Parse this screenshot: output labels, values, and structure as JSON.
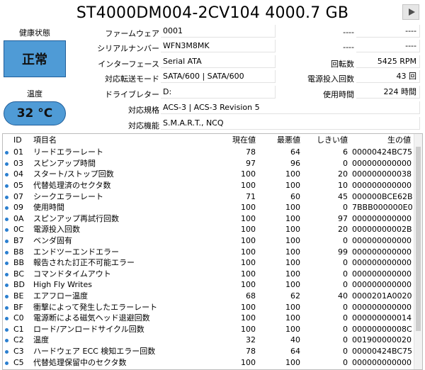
{
  "title": "ST4000DM004-2CV104 4000.7 GB",
  "health": {
    "label": "健康状態",
    "value": "正常",
    "color": "#4f9bd6"
  },
  "temperature": {
    "label": "温度",
    "value": "32 °C",
    "color": "#4f9bd6"
  },
  "info": {
    "firmware": {
      "label": "ファームウェア",
      "value": "0001"
    },
    "serial": {
      "label": "シリアルナンバー",
      "value": "WFN3M8MK"
    },
    "interface": {
      "label": "インターフェース",
      "value": "Serial ATA"
    },
    "transfer": {
      "label": "対応転送モード",
      "value": "SATA/600 | SATA/600"
    },
    "drive_letter": {
      "label": "ドライブレター",
      "value": "D:"
    },
    "standard": {
      "label": "対応規格",
      "value": "ACS-3 | ACS-3 Revision 5"
    },
    "features": {
      "label": "対応機能",
      "value": "S.M.A.R.T., NCQ"
    },
    "right_top_label": "----",
    "right_top_value": "----",
    "right_2_label": "----",
    "right_2_value": "----",
    "rotation": {
      "label": "回転数",
      "value": "5425 RPM"
    },
    "power_count": {
      "label": "電源投入回数",
      "value": "43 回"
    },
    "power_hours": {
      "label": "使用時間",
      "value": "224 時間"
    }
  },
  "table": {
    "headers": {
      "id": "ID",
      "name": "項目名",
      "current": "現在値",
      "worst": "最悪値",
      "threshold": "しきい値",
      "raw": "生の値"
    },
    "rows": [
      {
        "id": "01",
        "name": "リードエラーレート",
        "current": "78",
        "worst": "64",
        "threshold": "6",
        "raw": "00000424BC75"
      },
      {
        "id": "03",
        "name": "スピンアップ時間",
        "current": "97",
        "worst": "96",
        "threshold": "0",
        "raw": "000000000000"
      },
      {
        "id": "04",
        "name": "スタート/ストップ回数",
        "current": "100",
        "worst": "100",
        "threshold": "20",
        "raw": "000000000038"
      },
      {
        "id": "05",
        "name": "代替処理済のセクタ数",
        "current": "100",
        "worst": "100",
        "threshold": "10",
        "raw": "000000000000"
      },
      {
        "id": "07",
        "name": "シークエラーレート",
        "current": "71",
        "worst": "60",
        "threshold": "45",
        "raw": "000000BCE62B"
      },
      {
        "id": "09",
        "name": "使用時間",
        "current": "100",
        "worst": "100",
        "threshold": "0",
        "raw": "7BBB000000E0"
      },
      {
        "id": "0A",
        "name": "スピンアップ再試行回数",
        "current": "100",
        "worst": "100",
        "threshold": "97",
        "raw": "000000000000"
      },
      {
        "id": "0C",
        "name": "電源投入回数",
        "current": "100",
        "worst": "100",
        "threshold": "20",
        "raw": "00000000002B"
      },
      {
        "id": "B7",
        "name": "ベンダ固有",
        "current": "100",
        "worst": "100",
        "threshold": "0",
        "raw": "000000000000"
      },
      {
        "id": "B8",
        "name": "エンドツーエンドエラー",
        "current": "100",
        "worst": "100",
        "threshold": "99",
        "raw": "000000000000"
      },
      {
        "id": "BB",
        "name": "報告された訂正不可能エラー",
        "current": "100",
        "worst": "100",
        "threshold": "0",
        "raw": "000000000000"
      },
      {
        "id": "BC",
        "name": "コマンドタイムアウト",
        "current": "100",
        "worst": "100",
        "threshold": "0",
        "raw": "000000000000"
      },
      {
        "id": "BD",
        "name": "High Fly Writes",
        "current": "100",
        "worst": "100",
        "threshold": "0",
        "raw": "000000000000"
      },
      {
        "id": "BE",
        "name": "エアフロー温度",
        "current": "68",
        "worst": "62",
        "threshold": "40",
        "raw": "0000201A0020"
      },
      {
        "id": "BF",
        "name": "衝撃によって発生したエラーレート",
        "current": "100",
        "worst": "100",
        "threshold": "0",
        "raw": "000000000000"
      },
      {
        "id": "C0",
        "name": "電源断による磁気ヘッド退避回数",
        "current": "100",
        "worst": "100",
        "threshold": "0",
        "raw": "000000000014"
      },
      {
        "id": "C1",
        "name": "ロード/アンロードサイクル回数",
        "current": "100",
        "worst": "100",
        "threshold": "0",
        "raw": "00000000008C"
      },
      {
        "id": "C2",
        "name": "温度",
        "current": "32",
        "worst": "40",
        "threshold": "0",
        "raw": "001900000020"
      },
      {
        "id": "C3",
        "name": "ハードウェア ECC 検知エラー回数",
        "current": "78",
        "worst": "64",
        "threshold": "0",
        "raw": "00000424BC75"
      },
      {
        "id": "C5",
        "name": "代替処理保留中のセクタ数",
        "current": "100",
        "worst": "100",
        "threshold": "0",
        "raw": "000000000000"
      }
    ]
  }
}
